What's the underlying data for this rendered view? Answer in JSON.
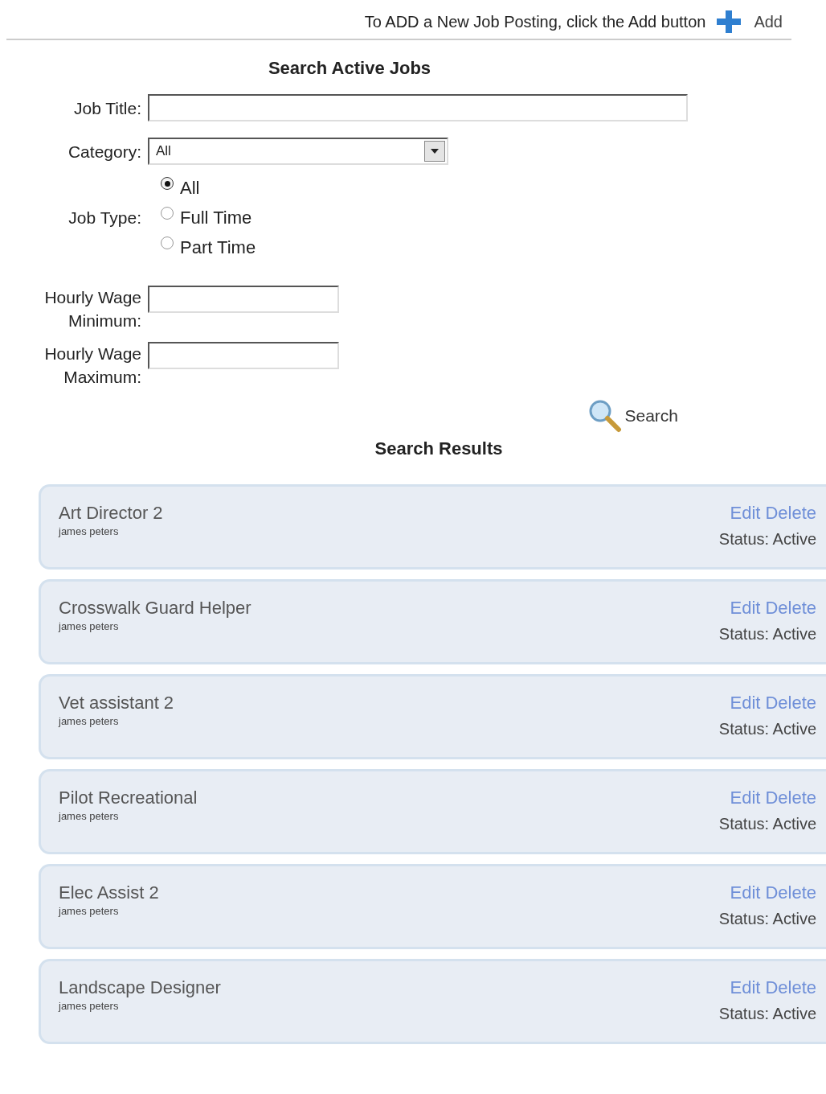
{
  "header": {
    "hint": "To ADD a New Job Posting, click the Add button",
    "add_label": "Add"
  },
  "search": {
    "title": "Search Active Jobs",
    "job_title": {
      "label": "Job Title:"
    },
    "category": {
      "label": "Category:",
      "value": "All"
    },
    "job_type": {
      "label": "Job Type:",
      "options": [
        {
          "label": "All",
          "selected": true
        },
        {
          "label": "Full Time",
          "selected": false
        },
        {
          "label": "Part Time",
          "selected": false
        }
      ]
    },
    "wage_min": {
      "label": "Hourly Wage Minimum:"
    },
    "wage_max": {
      "label": "Hourly Wage Maximum:"
    },
    "button": "Search"
  },
  "results": {
    "title": "Search Results",
    "items": [
      {
        "title": "Art Director 2",
        "owner": "james peters",
        "edit": "Edit",
        "delete": "Delete",
        "status": "Status: Active"
      },
      {
        "title": "Crosswalk Guard Helper",
        "owner": "james peters",
        "edit": "Edit",
        "delete": "Delete",
        "status": "Status: Active"
      },
      {
        "title": "Vet assistant 2",
        "owner": "james peters",
        "edit": "Edit",
        "delete": "Delete",
        "status": "Status: Active"
      },
      {
        "title": "Pilot Recreational",
        "owner": "james peters",
        "edit": "Edit",
        "delete": "Delete",
        "status": "Status: Active"
      },
      {
        "title": "Elec Assist 2",
        "owner": "james peters",
        "edit": "Edit",
        "delete": "Delete",
        "status": "Status: Active"
      },
      {
        "title": "Landscape Designer",
        "owner": "james peters",
        "edit": "Edit",
        "delete": "Delete",
        "status": "Status: Active"
      }
    ]
  }
}
